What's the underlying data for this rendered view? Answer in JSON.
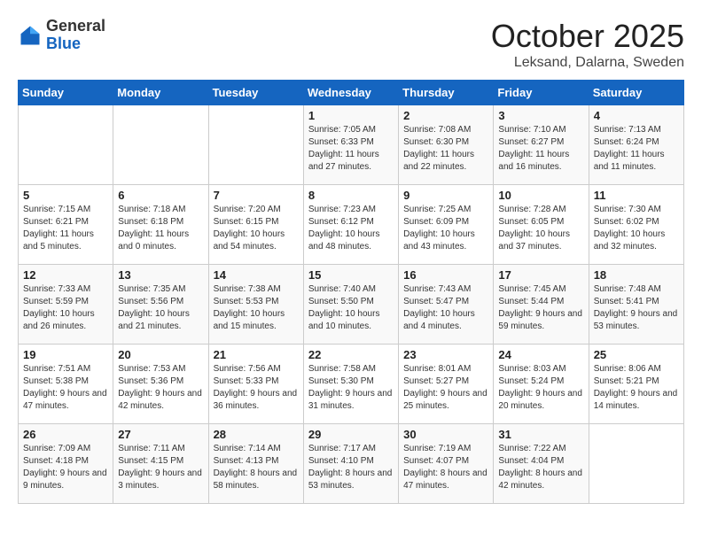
{
  "header": {
    "logo_general": "General",
    "logo_blue": "Blue",
    "month_title": "October 2025",
    "location": "Leksand, Dalarna, Sweden"
  },
  "days_of_week": [
    "Sunday",
    "Monday",
    "Tuesday",
    "Wednesday",
    "Thursday",
    "Friday",
    "Saturday"
  ],
  "weeks": [
    [
      {
        "day": "",
        "info": ""
      },
      {
        "day": "",
        "info": ""
      },
      {
        "day": "",
        "info": ""
      },
      {
        "day": "1",
        "info": "Sunrise: 7:05 AM\nSunset: 6:33 PM\nDaylight: 11 hours and 27 minutes."
      },
      {
        "day": "2",
        "info": "Sunrise: 7:08 AM\nSunset: 6:30 PM\nDaylight: 11 hours and 22 minutes."
      },
      {
        "day": "3",
        "info": "Sunrise: 7:10 AM\nSunset: 6:27 PM\nDaylight: 11 hours and 16 minutes."
      },
      {
        "day": "4",
        "info": "Sunrise: 7:13 AM\nSunset: 6:24 PM\nDaylight: 11 hours and 11 minutes."
      }
    ],
    [
      {
        "day": "5",
        "info": "Sunrise: 7:15 AM\nSunset: 6:21 PM\nDaylight: 11 hours and 5 minutes."
      },
      {
        "day": "6",
        "info": "Sunrise: 7:18 AM\nSunset: 6:18 PM\nDaylight: 11 hours and 0 minutes."
      },
      {
        "day": "7",
        "info": "Sunrise: 7:20 AM\nSunset: 6:15 PM\nDaylight: 10 hours and 54 minutes."
      },
      {
        "day": "8",
        "info": "Sunrise: 7:23 AM\nSunset: 6:12 PM\nDaylight: 10 hours and 48 minutes."
      },
      {
        "day": "9",
        "info": "Sunrise: 7:25 AM\nSunset: 6:09 PM\nDaylight: 10 hours and 43 minutes."
      },
      {
        "day": "10",
        "info": "Sunrise: 7:28 AM\nSunset: 6:05 PM\nDaylight: 10 hours and 37 minutes."
      },
      {
        "day": "11",
        "info": "Sunrise: 7:30 AM\nSunset: 6:02 PM\nDaylight: 10 hours and 32 minutes."
      }
    ],
    [
      {
        "day": "12",
        "info": "Sunrise: 7:33 AM\nSunset: 5:59 PM\nDaylight: 10 hours and 26 minutes."
      },
      {
        "day": "13",
        "info": "Sunrise: 7:35 AM\nSunset: 5:56 PM\nDaylight: 10 hours and 21 minutes."
      },
      {
        "day": "14",
        "info": "Sunrise: 7:38 AM\nSunset: 5:53 PM\nDaylight: 10 hours and 15 minutes."
      },
      {
        "day": "15",
        "info": "Sunrise: 7:40 AM\nSunset: 5:50 PM\nDaylight: 10 hours and 10 minutes."
      },
      {
        "day": "16",
        "info": "Sunrise: 7:43 AM\nSunset: 5:47 PM\nDaylight: 10 hours and 4 minutes."
      },
      {
        "day": "17",
        "info": "Sunrise: 7:45 AM\nSunset: 5:44 PM\nDaylight: 9 hours and 59 minutes."
      },
      {
        "day": "18",
        "info": "Sunrise: 7:48 AM\nSunset: 5:41 PM\nDaylight: 9 hours and 53 minutes."
      }
    ],
    [
      {
        "day": "19",
        "info": "Sunrise: 7:51 AM\nSunset: 5:38 PM\nDaylight: 9 hours and 47 minutes."
      },
      {
        "day": "20",
        "info": "Sunrise: 7:53 AM\nSunset: 5:36 PM\nDaylight: 9 hours and 42 minutes."
      },
      {
        "day": "21",
        "info": "Sunrise: 7:56 AM\nSunset: 5:33 PM\nDaylight: 9 hours and 36 minutes."
      },
      {
        "day": "22",
        "info": "Sunrise: 7:58 AM\nSunset: 5:30 PM\nDaylight: 9 hours and 31 minutes."
      },
      {
        "day": "23",
        "info": "Sunrise: 8:01 AM\nSunset: 5:27 PM\nDaylight: 9 hours and 25 minutes."
      },
      {
        "day": "24",
        "info": "Sunrise: 8:03 AM\nSunset: 5:24 PM\nDaylight: 9 hours and 20 minutes."
      },
      {
        "day": "25",
        "info": "Sunrise: 8:06 AM\nSunset: 5:21 PM\nDaylight: 9 hours and 14 minutes."
      }
    ],
    [
      {
        "day": "26",
        "info": "Sunrise: 7:09 AM\nSunset: 4:18 PM\nDaylight: 9 hours and 9 minutes."
      },
      {
        "day": "27",
        "info": "Sunrise: 7:11 AM\nSunset: 4:15 PM\nDaylight: 9 hours and 3 minutes."
      },
      {
        "day": "28",
        "info": "Sunrise: 7:14 AM\nSunset: 4:13 PM\nDaylight: 8 hours and 58 minutes."
      },
      {
        "day": "29",
        "info": "Sunrise: 7:17 AM\nSunset: 4:10 PM\nDaylight: 8 hours and 53 minutes."
      },
      {
        "day": "30",
        "info": "Sunrise: 7:19 AM\nSunset: 4:07 PM\nDaylight: 8 hours and 47 minutes."
      },
      {
        "day": "31",
        "info": "Sunrise: 7:22 AM\nSunset: 4:04 PM\nDaylight: 8 hours and 42 minutes."
      },
      {
        "day": "",
        "info": ""
      }
    ]
  ]
}
